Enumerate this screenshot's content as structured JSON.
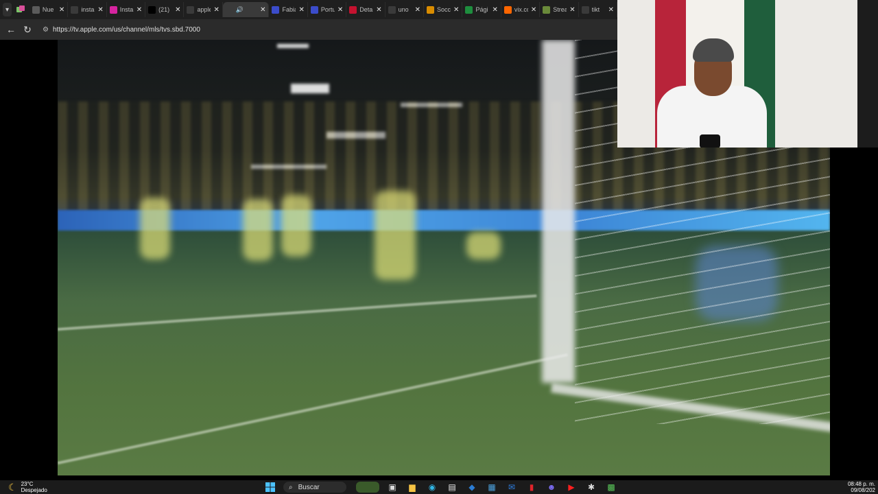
{
  "browser": {
    "tabs": [
      {
        "label": "Nue",
        "favicon": "new-tab-icon",
        "color": "#5b5b5b",
        "active": false
      },
      {
        "label": "insta",
        "favicon": "search-icon",
        "color": "#3a3a3a",
        "active": false
      },
      {
        "label": "Insta",
        "favicon": "instagram-icon",
        "color": "#d6249f",
        "active": false
      },
      {
        "label": "(21)",
        "favicon": "x-icon",
        "color": "#000000",
        "active": false
      },
      {
        "label": "apple",
        "favicon": "search-icon",
        "color": "#3a3a3a",
        "active": false
      },
      {
        "label": "",
        "favicon": "audio-playing-icon",
        "color": "#3a3a3a",
        "active": true
      },
      {
        "label": "Fabia",
        "favicon": "page-icon",
        "color": "#3b4cca",
        "active": false
      },
      {
        "label": "Portu",
        "favicon": "page-icon",
        "color": "#3b4cca",
        "active": false
      },
      {
        "label": "Deta",
        "favicon": "play-icon",
        "color": "#c4122f",
        "active": false
      },
      {
        "label": "uno",
        "favicon": "search-icon",
        "color": "#3a3a3a",
        "active": false
      },
      {
        "label": "Socc",
        "favicon": "shield-icon",
        "color": "#d98c00",
        "active": false
      },
      {
        "label": "Pági",
        "favicon": "drive-icon",
        "color": "#1e8e3e",
        "active": false
      },
      {
        "label": "vix.co",
        "favicon": "vix-icon",
        "color": "#ff6600",
        "active": false
      },
      {
        "label": "Strea",
        "favicon": "leaf-icon",
        "color": "#6a8a3a",
        "active": false
      },
      {
        "label": "tikt",
        "favicon": "search-icon",
        "color": "#3a3a3a",
        "active": false
      }
    ],
    "url": "https://tv.apple.com/us/channel/mls/tvs.sbd.7000"
  },
  "taskbar": {
    "temperature": "23°C",
    "weather": "Despejado",
    "search_label": "Buscar",
    "time": "08:48 p. m.",
    "date": "09/08/202"
  }
}
